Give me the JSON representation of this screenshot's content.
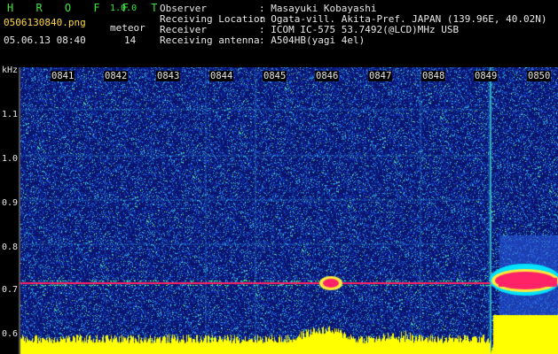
{
  "app": {
    "name": "H R O F F T",
    "version": "1.0.0",
    "filename": "0506130840.png",
    "meteor_label": "meteor",
    "meteor_count": "14",
    "datetime": "05.06.13 08:40"
  },
  "info": {
    "observer_label": "Observer",
    "observer_value": ": Masayuki Kobayashi",
    "location_label": "Receiving Location",
    "location_value": ": Ogata-vill. Akita-Pref. JAPAN (139.96E, 40.02N)",
    "receiver_label": "Receiver",
    "receiver_value": ": ICOM IC-575 53.7492(@LCD)MHz USB",
    "antenna_label": "Receiving antenna",
    "antenna_value": ": A504HB(yagi 4el)"
  },
  "axis": {
    "unit": "kHz",
    "y_ticks": [
      "1.1",
      "1.0",
      "0.9",
      "0.8",
      "0.7",
      "0.6"
    ],
    "x_ticks": [
      "0841",
      "0842",
      "0843",
      "0844",
      "0845",
      "0846",
      "0847",
      "0848",
      "0849",
      "0850"
    ]
  },
  "colors": {
    "background": "#000000",
    "header_green": "#39e639",
    "header_white": "#e8e8e8",
    "header_yellow": "#ffd84a",
    "spectrum_base": "#0a1a80",
    "signal_line": "#ff2266",
    "histogram": "#ffff00"
  }
}
